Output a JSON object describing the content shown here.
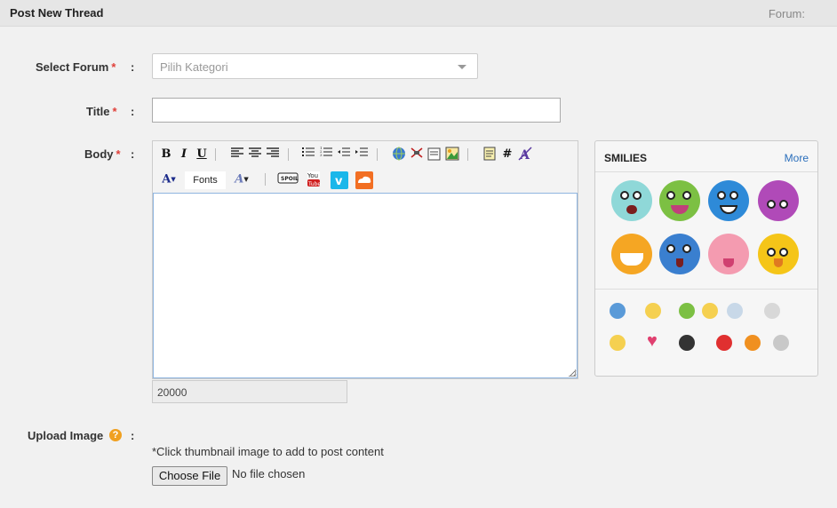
{
  "header": {
    "title": "Post New Thread",
    "forum_label": "Forum:"
  },
  "form": {
    "select_forum": {
      "label": "Select Forum",
      "required_mark": "*",
      "colon": ":",
      "value": "Pilih Kategori"
    },
    "title": {
      "label": "Title",
      "required_mark": "*",
      "colon": ":",
      "value": ""
    },
    "body": {
      "label": "Body",
      "required_mark": "*",
      "colon": ":",
      "value": "",
      "char_counter": "20000"
    },
    "upload_image": {
      "label": "Upload Image",
      "help": "?",
      "colon": ":",
      "hint": "*Click thumbnail image to add to post content",
      "button_label": "Choose File",
      "file_status": "No file chosen"
    }
  },
  "toolbar": {
    "row1": [
      "bold-icon",
      "italic-icon",
      "underline-icon",
      "align-left-icon",
      "align-center-icon",
      "align-right-icon",
      "bulleted-list-icon",
      "numbered-list-icon",
      "outdent-icon",
      "indent-icon",
      "link-icon",
      "unlink-icon",
      "email-icon",
      "image-icon",
      "quote-icon",
      "hashtag-icon",
      "remove-format-icon"
    ],
    "row2": [
      "font-color-icon",
      "font-size-icon",
      "spoiler-icon",
      "youtube-icon",
      "vimeo-icon",
      "soundcloud-icon"
    ],
    "bold_glyph": "B",
    "italic_glyph": "I",
    "underline_glyph": "U",
    "hash_glyph": "#",
    "font_color_glyph": "A",
    "font_size_glyph": "A",
    "fonts_label": "Fonts"
  },
  "smilies": {
    "title": "SMILIES",
    "more_label": "More",
    "colors": {
      "cyan": "#8fd8d8",
      "green": "#7cc043",
      "blue": "#2e8ad8",
      "purple": "#b04ab8",
      "orange": "#f5a623",
      "blue2": "#3a7fcf",
      "pink": "#f49bb0",
      "yellow": "#f5c518"
    }
  },
  "colors": {
    "required": "#e0403a",
    "link": "#2a6ebb",
    "editor_focus_border": "#8fb5e0",
    "help_icon": "#f0a020"
  }
}
